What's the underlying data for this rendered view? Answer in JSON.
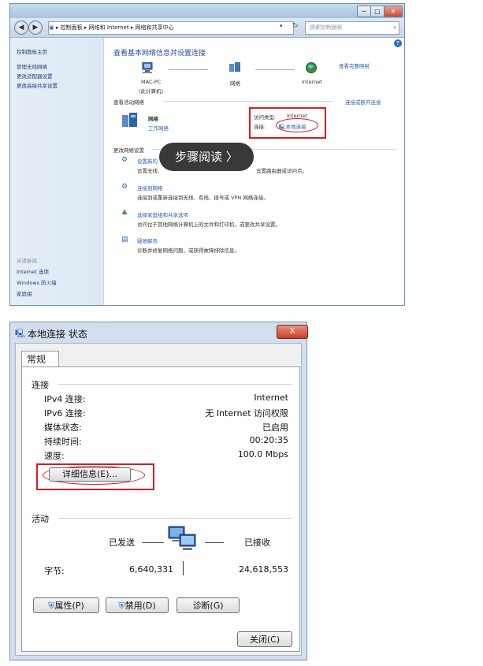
{
  "network_center": {
    "breadcrumb": [
      "控制面板",
      "网络和 Internet",
      "网络和共享中心"
    ],
    "search_placeholder": "搜索控制面板",
    "help": "?",
    "sidebar": {
      "items": [
        "控制面板主页",
        "管理无线网络",
        "更改适配器设置",
        "更改高级共享设置"
      ],
      "see_also_title": "另请参阅",
      "see_also": [
        "Internet 选项",
        "Windows 防火墙",
        "家庭组"
      ]
    },
    "title": "查看基本网络信息并设置连接",
    "full_map": "查看完整映射",
    "map": {
      "pc_name": "MAC-PC",
      "pc_sub": "(此计算机)",
      "network": "网络",
      "internet": "Internet"
    },
    "active_title": "查看活动网络",
    "connect_disconnect": "连接或断开连接",
    "active": {
      "name": "网络",
      "type": "工作网络",
      "access_label": "访问类型:",
      "access_value": "Internet",
      "conn_label": "连接:",
      "conn_value": "本地连接"
    },
    "settings_title": "更改网络设置",
    "tasks": [
      {
        "title": "设置新的",
        "desc": "设置无线、",
        "desc2": "设置路由器或访问点。"
      },
      {
        "title": "连接到网络",
        "desc": "连接到或重新连接到无线、有线、拨号或 VPN 网络连接。"
      },
      {
        "title": "选择家庭组和共享选项",
        "desc": "访问位于其他网络计算机上的文件和打印机，或更改共享设置。"
      },
      {
        "title": "疑难解答",
        "desc": "诊断并修复网络问题，或获得故障排除信息。"
      }
    ],
    "overlay": "步骤阅读 〉"
  },
  "status_dialog": {
    "title": "本地连接 状态",
    "close": "X",
    "tab": "常规",
    "connection": {
      "heading": "连接",
      "rows": [
        {
          "label": "IPv4 连接:",
          "value": "Internet"
        },
        {
          "label": "IPv6 连接:",
          "value": "无 Internet 访问权限"
        },
        {
          "label": "媒体状态:",
          "value": "已启用"
        },
        {
          "label": "持续时间:",
          "value": "00:20:35"
        },
        {
          "label": "速度:",
          "value": "100.0 Mbps"
        }
      ],
      "details_button": "详细信息(E)..."
    },
    "activity": {
      "heading": "活动",
      "sent_label": "已发送",
      "received_label": "已接收",
      "bytes_label": "字节:",
      "bytes_sent": "6,640,331",
      "bytes_received": "24,618,553"
    },
    "buttons": {
      "properties": "属性(P)",
      "disable": "禁用(D)",
      "diagnose": "诊断(G)",
      "close": "关闭(C)"
    }
  }
}
